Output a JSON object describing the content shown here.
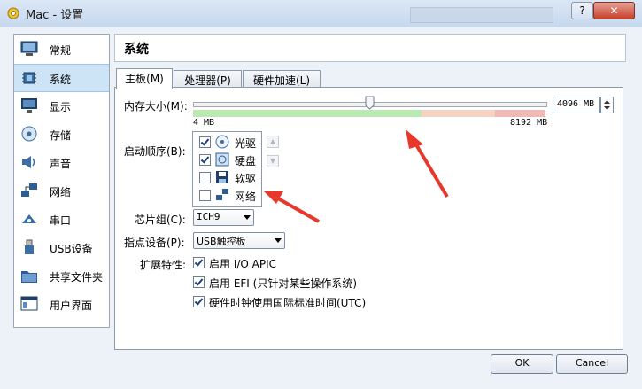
{
  "window": {
    "title": "Mac - 设置",
    "help_glyph": "?",
    "close_glyph": "✕"
  },
  "sidebar": {
    "items": [
      {
        "label": "常规",
        "icon": "monitor-icon"
      },
      {
        "label": "系统",
        "icon": "chip-icon",
        "selected": true
      },
      {
        "label": "显示",
        "icon": "display-icon"
      },
      {
        "label": "存储",
        "icon": "disk-icon"
      },
      {
        "label": "声音",
        "icon": "speaker-icon"
      },
      {
        "label": "网络",
        "icon": "network-icon"
      },
      {
        "label": "串口",
        "icon": "serial-port-icon"
      },
      {
        "label": "USB设备",
        "icon": "usb-icon"
      },
      {
        "label": "共享文件夹",
        "icon": "folder-icon"
      },
      {
        "label": "用户界面",
        "icon": "ui-window-icon"
      }
    ]
  },
  "panel": {
    "title": "系统"
  },
  "tabs": [
    {
      "label": "主板(M)",
      "active": true
    },
    {
      "label": "处理器(P)"
    },
    {
      "label": "硬件加速(L)"
    }
  ],
  "motherboard": {
    "memory_label": "内存大小(M):",
    "memory_value": "4096 MB",
    "memory_fraction": 0.5,
    "memory_min": "4 MB",
    "memory_max": "8192 MB",
    "boot_label": "启动顺序(B):",
    "boot_items": [
      {
        "label": "光驱",
        "checked": true,
        "icon": "optical-drive-icon"
      },
      {
        "label": "硬盘",
        "checked": true,
        "icon": "hard-disk-icon"
      },
      {
        "label": "软驱",
        "checked": false,
        "icon": "floppy-icon"
      },
      {
        "label": "网络",
        "checked": false,
        "icon": "network-icon"
      }
    ],
    "boot_up_glyph": "▲",
    "boot_down_glyph": "▼",
    "chipset_label": "芯片组(C):",
    "chipset_value": "ICH9",
    "pointing_label": "指点设备(P):",
    "pointing_value": "USB触控板",
    "ext_label": "扩展特性:",
    "features": [
      {
        "label": "启用 I/O APIC",
        "checked": true
      },
      {
        "label": "启用 EFI (只针对某些操作系统)",
        "checked": true
      },
      {
        "label": "硬件时钟使用国际标准时间(UTC)",
        "checked": true
      }
    ]
  },
  "buttons": {
    "ok": "OK",
    "cancel": "Cancel"
  },
  "colors": {
    "accent": "#cde4f7",
    "annotation_arrow": "#e8382b"
  }
}
